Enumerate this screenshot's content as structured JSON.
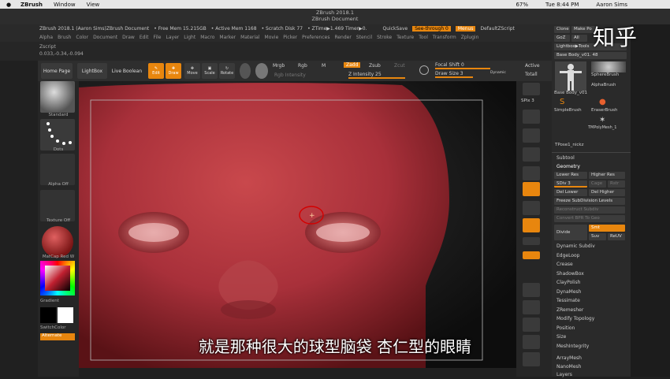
{
  "menubar": {
    "app": "ZBrush",
    "items": [
      "Window",
      "View"
    ],
    "battery": "67%",
    "time": "Tue 8:44 PM",
    "user": "Aaron Sims"
  },
  "title": {
    "app": "ZBrush 2018.1",
    "doc": "ZBrush Document"
  },
  "infobar": {
    "app_info": "ZBrush 2018.1 (Aaron Sims)ZBrush Document",
    "free_mem": "• Free Mem 15.215GB",
    "active_mem": "• Active Mem 1168",
    "scratch": "• Scratch Disk 77",
    "ztime": "• ZTime▶1.469 Timer▶0.",
    "quicksave": "QuickSave",
    "see_through": "See-through 0",
    "menus": "Menus",
    "script": "DefaultZScript"
  },
  "menus": [
    "Alpha",
    "Brush",
    "Color",
    "Document",
    "Draw",
    "Edit",
    "File",
    "Layer",
    "Light",
    "Macro",
    "Marker",
    "Material",
    "Movie",
    "Picker",
    "Preferences",
    "Render",
    "Stencil",
    "Stroke",
    "Texture",
    "Tool",
    "Transform",
    "Zplugin"
  ],
  "zscript": {
    "label": "Zscript",
    "coords": "0.033,-0.34,-0.094"
  },
  "toolbar": {
    "home": "Home Page",
    "lightbox": "LightBox",
    "live_boolean": "Live Boolean",
    "edit": "Edit",
    "draw": "Draw",
    "move": "Move",
    "scale": "Scale",
    "rotate": "Rotate",
    "mrgb": "Mrgb",
    "rgb": "Rgb",
    "m": "M",
    "zadd": "Zadd",
    "zsub": "Zsub",
    "zcut": "Zcut",
    "rgb_intensity": "Rgb Intensity",
    "z_intensity": "Z Intensity 25",
    "focal_shift": "Focal Shift 0",
    "draw_size": "Draw Size 3",
    "dynamic": "Dynamic",
    "active": "Active",
    "total": "Totall"
  },
  "left": {
    "standard": "Standard",
    "dots": "Dots",
    "alpha": "Alpha Off",
    "texture": "Texture Off",
    "material": "MatCap Red W",
    "gradient": "Gradient",
    "switch": "SwitchColor",
    "alternate": "Alternate"
  },
  "right": {
    "spix": "SPix 3",
    "items": [
      "Scroll",
      "Zoom",
      "Actual",
      "AAHalf",
      "Persp",
      "Floor",
      "Local",
      "L.Sym",
      "Gxyz",
      "Frame",
      "Move",
      "Scale",
      "Rotate",
      "Line Fill",
      "PolyF"
    ]
  },
  "panel": {
    "top": [
      "Clone",
      "Make Po"
    ],
    "row2": [
      "GoZ",
      "All"
    ],
    "lightbox": "Lightbox▶Tools",
    "tool": "Base Body_v01. 48",
    "brushes": [
      "SphereBrush",
      "AlphaBrush",
      "SimpleBrush",
      "EraserBrush",
      "TMPolyMesh_1"
    ],
    "tool_name": "Base Body_v01",
    "tpose": "TPose1_nickz",
    "subtool": "Subtool",
    "geometry": "Geometry",
    "lower": "Lower Res",
    "higher": "Higher Res",
    "sdiv": "SDiv 3",
    "cage": "Cage",
    "rstr": "Rstr",
    "del_lower": "Del Lower",
    "del_higher": "Del Higher",
    "freeze": "Freeze SubDivision Levels",
    "reconstruct": "Reconstruct Subdiv",
    "convert": "Convert BPR To Geo",
    "divide": "Divide",
    "smt": "Smt",
    "suv": "Suv",
    "reuv": "ReUV",
    "sections": [
      "Dynamic Subdiv",
      "EdgeLoop",
      "Crease",
      "ShadowBox",
      "ClayPolish",
      "DynaMesh",
      "Tessimate",
      "ZRemesher",
      "Modify Topology",
      "Position",
      "Size",
      "MeshIntegrity",
      "ArrayMesh",
      "NanoMesh",
      "Layers"
    ]
  },
  "subtitle": "就是那种很大的球型脑袋 杏仁型的眼睛",
  "watermark": "知乎",
  "colors": {
    "accent": "#e8860e",
    "skin": "#b2383d"
  }
}
